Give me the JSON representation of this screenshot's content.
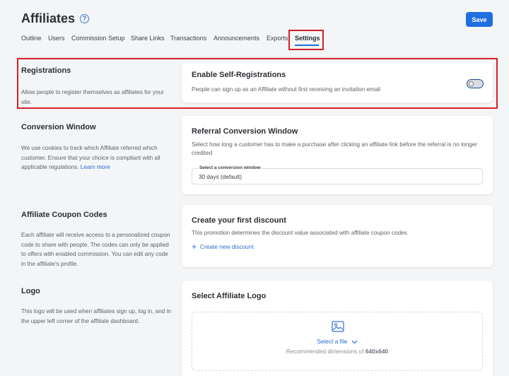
{
  "header": {
    "title": "Affiliates",
    "help_icon": "question-circle-icon",
    "save_label": "Save"
  },
  "tabs": [
    {
      "label": "Outline"
    },
    {
      "label": "Users"
    },
    {
      "label": "Commission Setup"
    },
    {
      "label": "Share Links"
    },
    {
      "label": "Transactions"
    },
    {
      "label": "Announcements"
    },
    {
      "label": "Exports"
    },
    {
      "label": "Settings",
      "active": true
    }
  ],
  "sections": {
    "registrations": {
      "title": "Registrations",
      "description": "Allow people to register themselves as affiliates for your site.",
      "card_title": "Enable Self-Registrations",
      "card_description": "People can sign up as an Affiliate without first receiving an invitation email",
      "toggle_enabled": false
    },
    "conversion": {
      "title": "Conversion Window",
      "description": "We use cookies to track which Affiliate referred which customer. Ensure that your choice is compliant with all applicable regulations.",
      "learn_more": "Learn more",
      "card_title": "Referral Conversion Window",
      "card_description": "Select how long a customer has to make a purchase after clicking an affiliate link before the referral is no longer credited",
      "select_label": "Select a conversion window",
      "select_value": "30 days (default)"
    },
    "coupons": {
      "title": "Affiliate Coupon Codes",
      "description": "Each affiliate will receive access to a personalized coupon code to share with people. The codes can only be applied to offers with enabled commission. You can edit any code in the affiliate's profile.",
      "card_title": "Create your first discount",
      "card_description": "This promotion determines the discount value associated with affiliate coupon codes.",
      "create_label": "Create new discount"
    },
    "logo": {
      "title": "Logo",
      "description": "This logo will be used when affiliates sign up, log in, and in the upper left corner of the affiliate dashboard.",
      "card_title": "Select Affiliate Logo",
      "select_file": "Select a file",
      "rec_prefix": "Recommended dimensions of",
      "rec_value": "640x640"
    }
  },
  "colors": {
    "accent": "#1f6fe0",
    "highlight": "#d71f26",
    "background": "#f4f5f7"
  }
}
